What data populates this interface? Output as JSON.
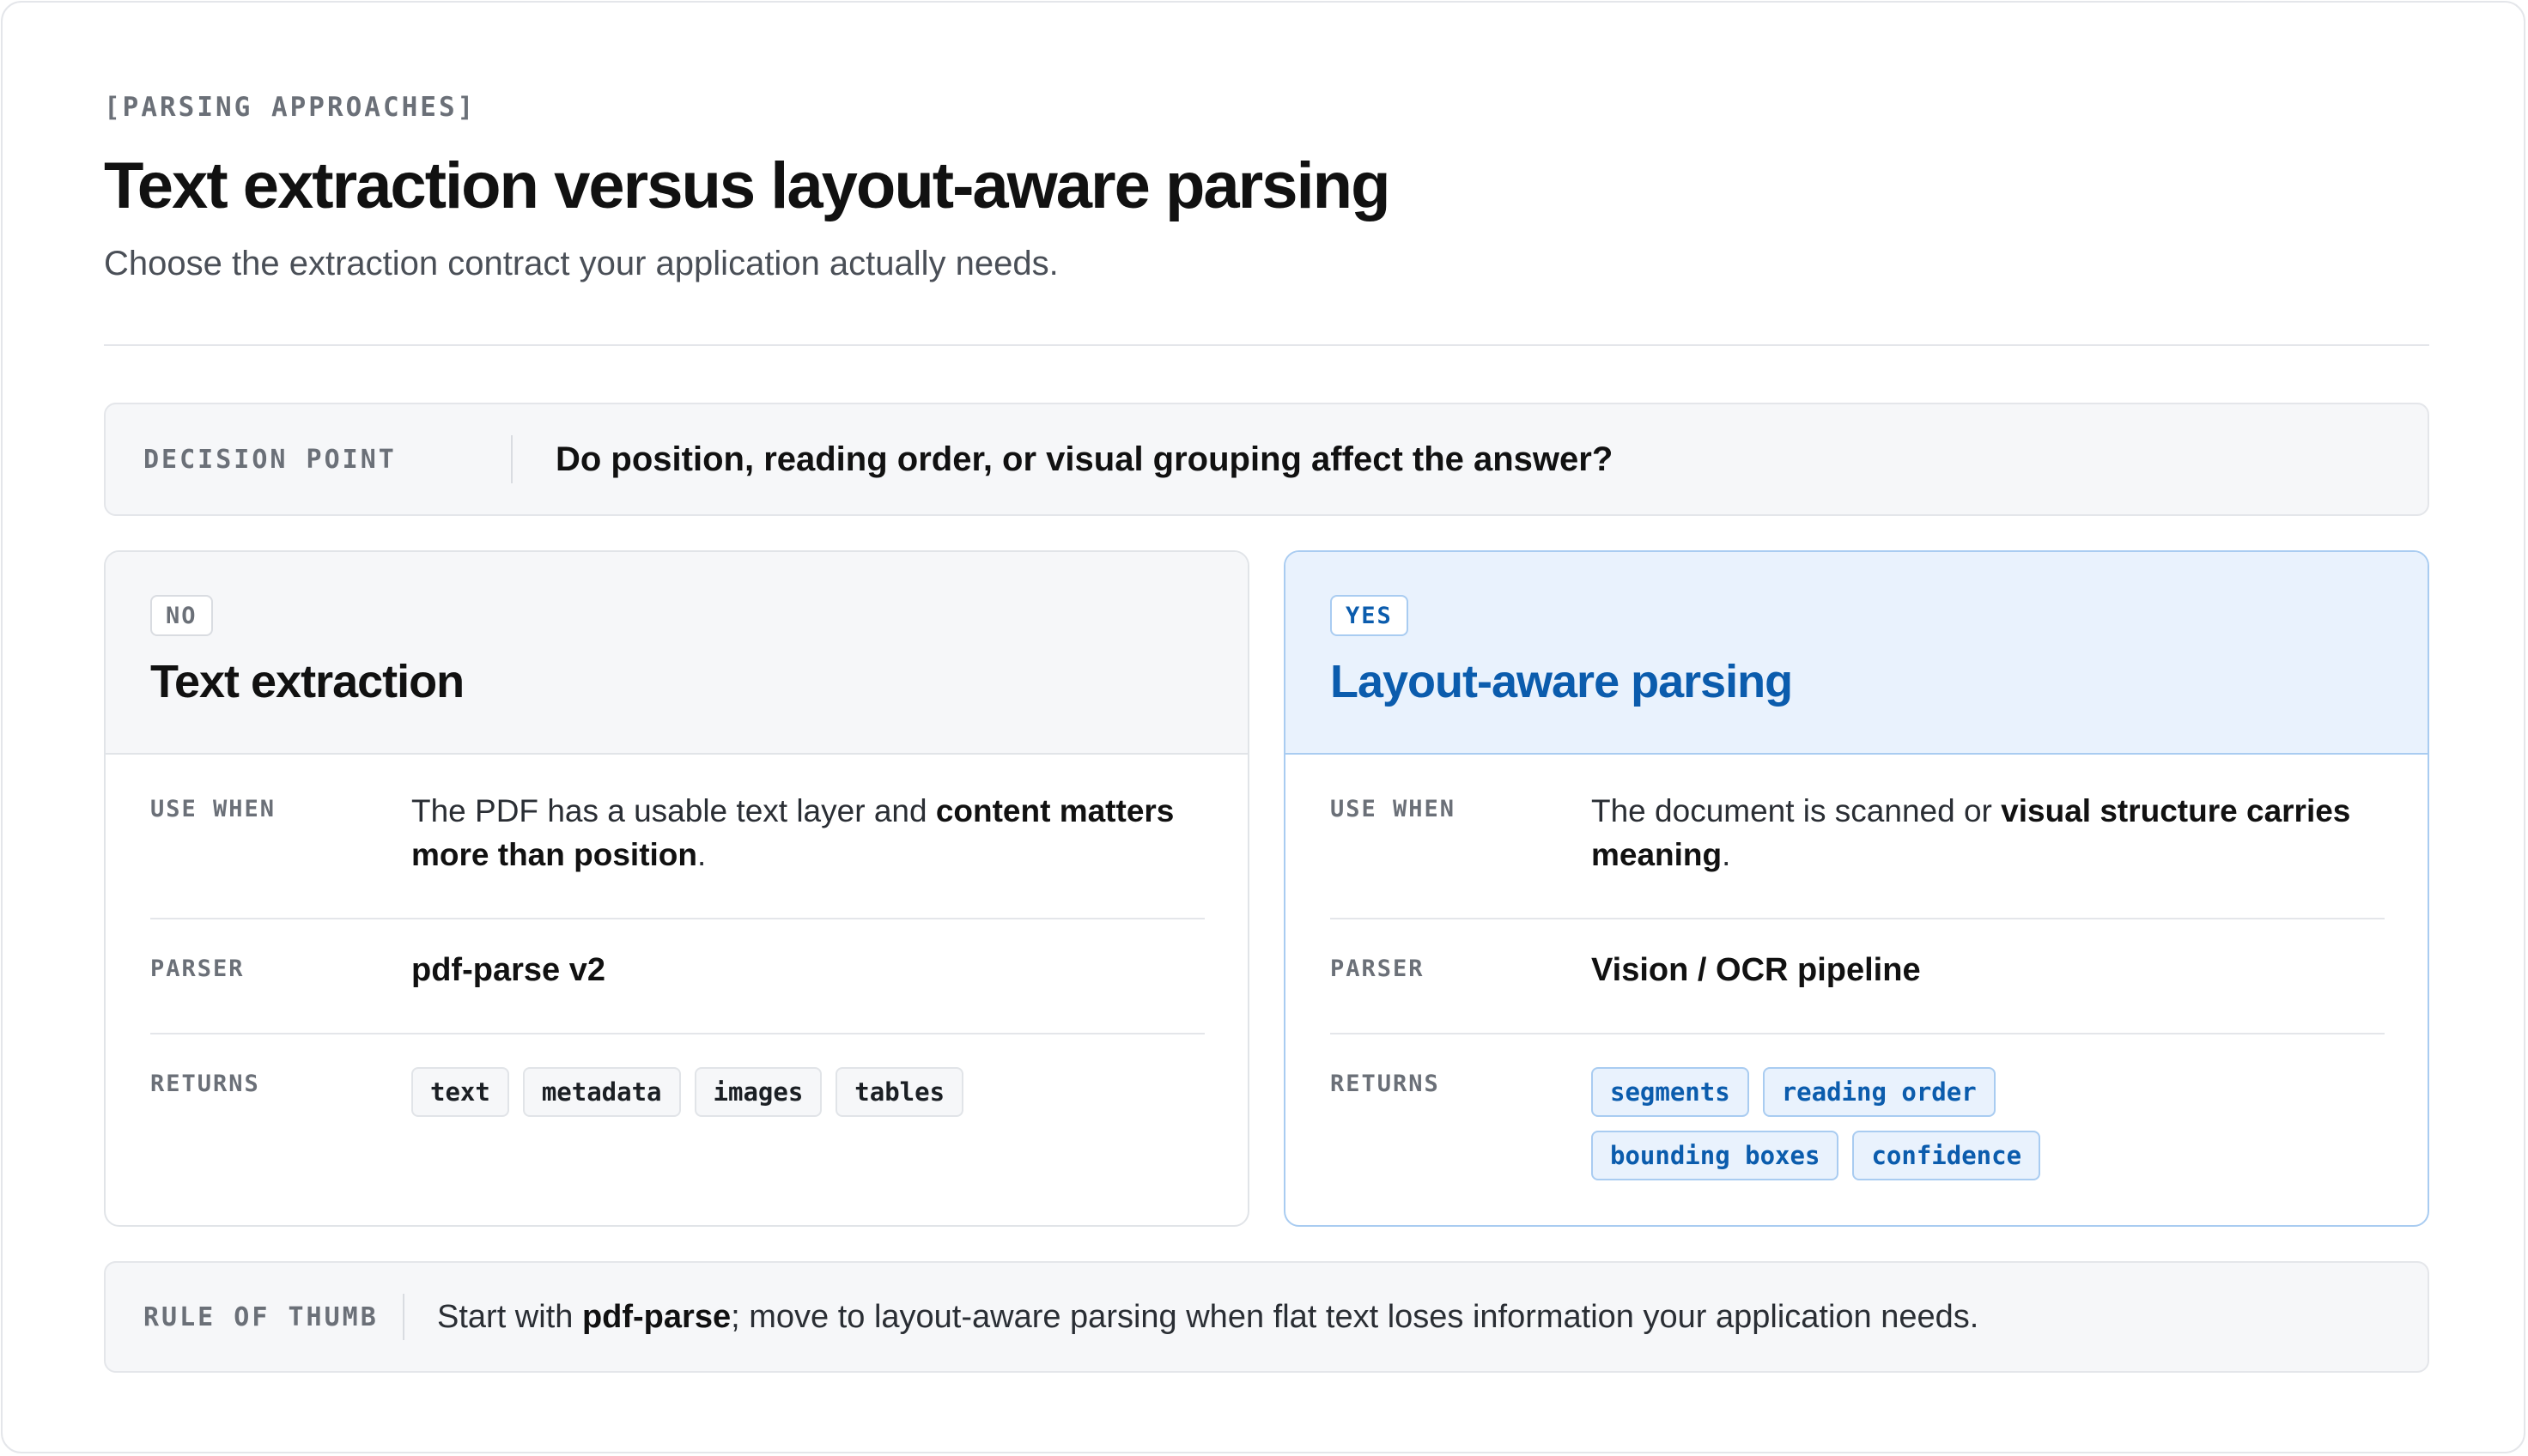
{
  "header": {
    "eyebrow": "[PARSING APPROACHES]",
    "title": "Text extraction versus layout-aware parsing",
    "subtitle": "Choose the extraction contract your application actually needs."
  },
  "decision": {
    "label": "DECISION POINT",
    "question": "Do position, reading order, or visual grouping affect the answer?"
  },
  "cards": {
    "left": {
      "verdict": "NO",
      "title": "Text extraction",
      "use_when_label": "USE WHEN",
      "use_when_plain": "The PDF has a usable text layer and ",
      "use_when_bold": "content matters more than position",
      "use_when_end": ".",
      "parser_label": "PARSER",
      "parser": "pdf-parse v2",
      "returns_label": "RETURNS",
      "returns": [
        "text",
        "metadata",
        "images",
        "tables"
      ]
    },
    "right": {
      "verdict": "YES",
      "title": "Layout-aware parsing",
      "use_when_label": "USE WHEN",
      "use_when_plain": "The document is scanned or ",
      "use_when_bold": "visual structure carries meaning",
      "use_when_end": ".",
      "parser_label": "PARSER",
      "parser": "Vision / OCR pipeline",
      "returns_label": "RETURNS",
      "returns": [
        "segments",
        "reading order",
        "bounding boxes",
        "confidence"
      ]
    }
  },
  "rule_of_thumb": {
    "label": "RULE OF THUMB",
    "prefix": "Start with ",
    "bold": "pdf-parse",
    "suffix": "; move to layout-aware parsing when flat text loses information your application needs."
  },
  "colors": {
    "accent": "#0b5cad",
    "accent_bg": "#e9f2fd",
    "accent_border": "#a9ccf1",
    "muted_label": "#6b7078",
    "panel_bg": "#f6f7f9",
    "border": "#e4e6ea"
  }
}
